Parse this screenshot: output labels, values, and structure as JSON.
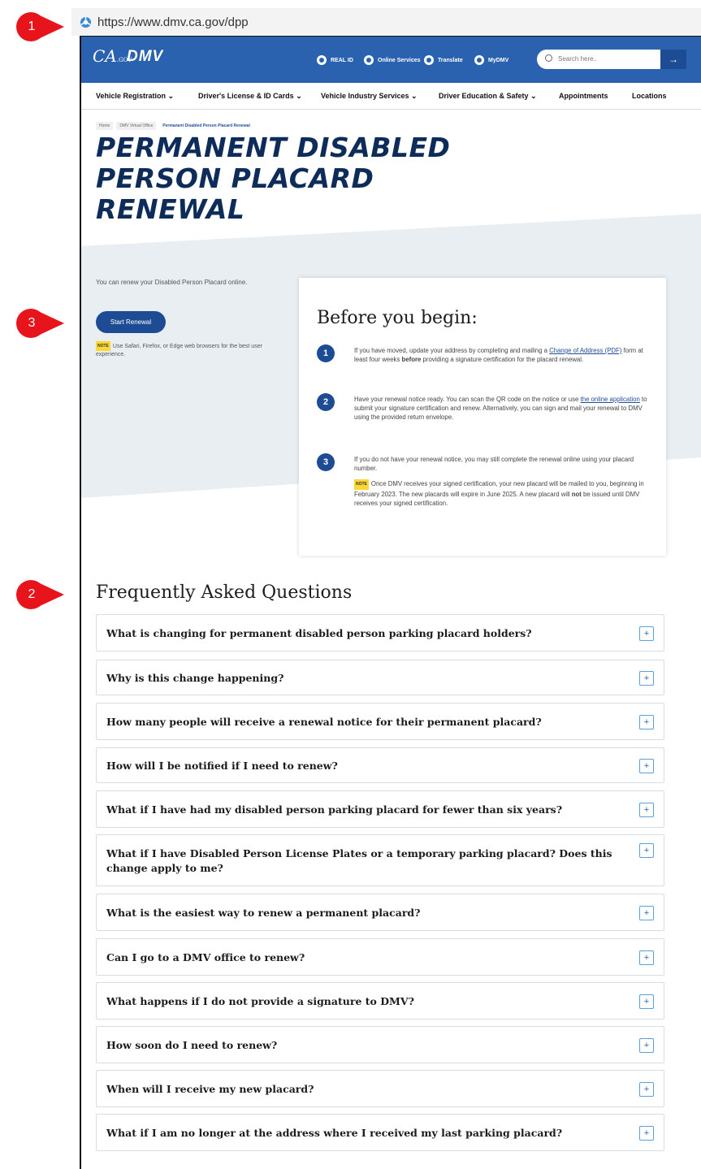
{
  "markers": [
    "1",
    "2",
    "3"
  ],
  "browser": {
    "url": "https://www.dmv.ca.gov/dpp"
  },
  "header": {
    "logo_ca": "CA",
    "logo_gov": ".GOV",
    "logo_dmv": "DMV",
    "links": [
      "REAL ID",
      "Online Services",
      "Translate",
      "MyDMV"
    ],
    "search_placeholder": "Search here..",
    "search_arrow": "→"
  },
  "nav": {
    "items": [
      "Vehicle Registration ⌄",
      "Driver's License & ID Cards ⌄",
      "Vehicle Industry Services ⌄",
      "Driver Education & Safety ⌄",
      "Appointments",
      "Locations"
    ]
  },
  "breadcrumb": [
    "Home",
    "DMV Virtual Office",
    "Permanent Disabled Person Placard Renewal"
  ],
  "page": {
    "title": "PERMANENT DISABLED PERSON PLACARD RENEWAL",
    "intro": "You can renew your Disabled Person Placard online.",
    "start_button": "Start Renewal",
    "note_label": "NOTE",
    "browser_note": "Use Safari, Firefox, or Edge web browsers for the best user experience."
  },
  "before": {
    "heading": "Before you begin:",
    "steps": [
      {
        "num": "1",
        "pre": "If you have moved, update your address by completing and mailing a ",
        "link": "Change of Address (PDF)",
        "mid": " form at least four weeks ",
        "bold": "before",
        "post": " providing a signature certification for the placard renewal."
      },
      {
        "num": "2",
        "pre": "Have your renewal notice ready. You can scan the QR code on the notice or use ",
        "link": "the online application",
        "post": " to submit your signature certification and renew. Alternatively, you can sign and mail your renewal to DMV using the provided return envelope."
      },
      {
        "num": "3",
        "text": "If you do not have your renewal notice, you may still complete the renewal online using your placard number.",
        "note_pre": "Once DMV receives your signed certification, your new placard will be mailed to you, beginning in February 2023. The new placards will expire in June 2025. A new placard will ",
        "note_bold": "not",
        "note_post": " be issued until DMV receives your signed certification."
      }
    ]
  },
  "faq": {
    "heading": "Frequently Asked Questions",
    "expand_symbol": "+",
    "questions": [
      "What is changing for permanent disabled person parking placard holders?",
      "Why is this change happening?",
      "How many people will receive a renewal notice for their permanent placard?",
      "How will I be notified if I need to renew?",
      "What if I have had my disabled person parking placard for fewer than six years?",
      "What if I have Disabled Person License Plates or a temporary parking placard? Does this change apply to me?",
      "What is the easiest way to renew a permanent placard?",
      "Can I go to a DMV office to renew?",
      "What happens if I do not provide a signature to DMV?",
      "How soon do I need to renew?",
      "When will I receive my new placard?",
      "What if I am no longer at the address where I received my last parking placard?"
    ]
  },
  "colors": {
    "brand_blue": "#2b62b0",
    "dark_blue": "#1d4c95",
    "title_navy": "#0d2c5a",
    "marker_red": "#e8141c",
    "band_bg": "#e9eef3",
    "note_yellow": "#fdd835"
  }
}
